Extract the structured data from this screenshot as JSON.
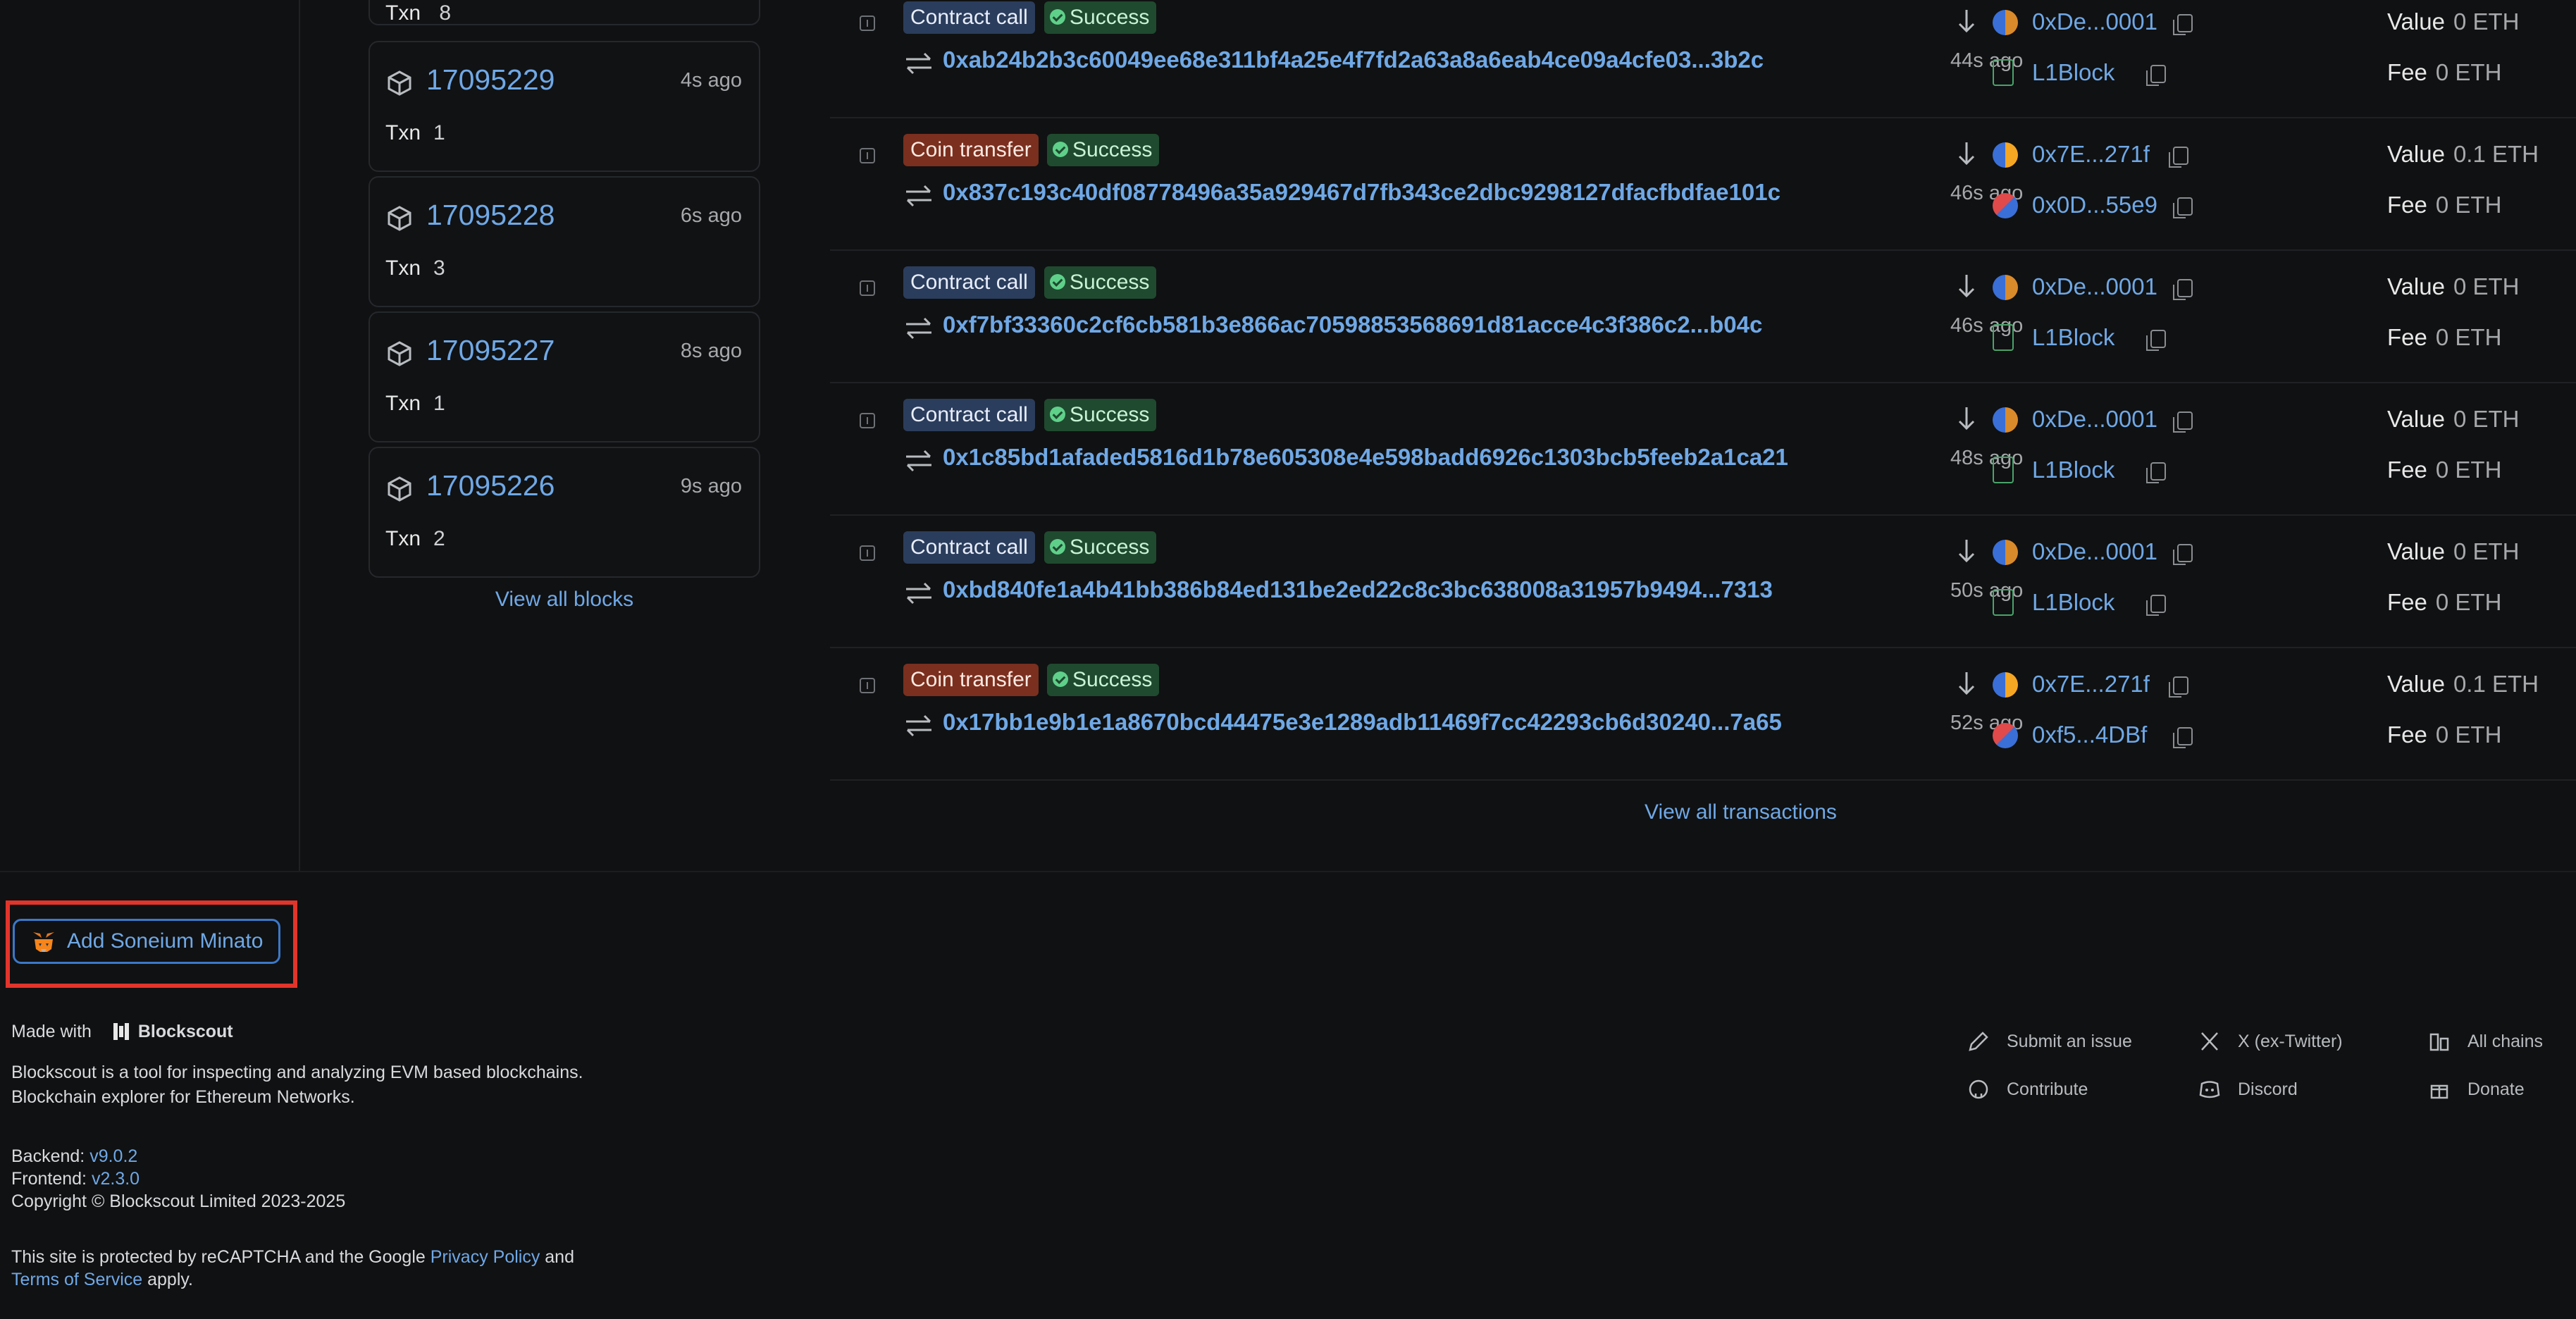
{
  "blocks": {
    "items": [
      {
        "number": "17095229",
        "age": "4s ago",
        "txn_label": "Txn",
        "txn_count": "1"
      },
      {
        "number": "17095228",
        "age": "6s ago",
        "txn_label": "Txn",
        "txn_count": "3"
      },
      {
        "number": "17095227",
        "age": "8s ago",
        "txn_label": "Txn",
        "txn_count": "1"
      },
      {
        "number": "17095226",
        "age": "9s ago",
        "txn_label": "Txn",
        "txn_count": "2"
      }
    ],
    "partial_top_label": "Txn 8",
    "view_all": "View all blocks"
  },
  "transactions": {
    "rows": [
      {
        "type": "Contract call",
        "status": "Success",
        "hash": "0xab24b2b3c60049ee68e311bf4a25e4f7fd2a63a8a6eab4ce09a4cfe03...3b2c",
        "age": "44s ago",
        "from": "0xDe...0001",
        "to": "L1Block",
        "value_label": "Value",
        "value": "0 ETH",
        "fee_label": "Fee",
        "fee": "0 ETH"
      },
      {
        "type": "Coin transfer",
        "status": "Success",
        "hash": "0x837c193c40df08778496a35a929467d7fb343ce2dbc9298127dfacfbdfae101c",
        "age": "46s ago",
        "from": "0x7E...271f",
        "to": "0x0D...55e9",
        "value_label": "Value",
        "value": "0.1 ETH",
        "fee_label": "Fee",
        "fee": "0 ETH"
      },
      {
        "type": "Contract call",
        "status": "Success",
        "hash": "0xf7bf33360c2cf6cb581b3e866ac70598853568691d81acce4c3f386c2...b04c",
        "age": "46s ago",
        "from": "0xDe...0001",
        "to": "L1Block",
        "value_label": "Value",
        "value": "0 ETH",
        "fee_label": "Fee",
        "fee": "0 ETH"
      },
      {
        "type": "Contract call",
        "status": "Success",
        "hash": "0x1c85bd1afaded5816d1b78e605308e4e598badd6926c1303bcb5feeb2a1ca21",
        "age": "48s ago",
        "from": "0xDe...0001",
        "to": "L1Block",
        "value_label": "Value",
        "value": "0 ETH",
        "fee_label": "Fee",
        "fee": "0 ETH"
      },
      {
        "type": "Contract call",
        "status": "Success",
        "hash": "0xbd840fe1a4b41bb386b84ed131be2ed22c8c3bc638008a31957b9494...7313",
        "age": "50s ago",
        "from": "0xDe...0001",
        "to": "L1Block",
        "value_label": "Value",
        "value": "0 ETH",
        "fee_label": "Fee",
        "fee": "0 ETH"
      },
      {
        "type": "Coin transfer",
        "status": "Success",
        "hash": "0x17bb1e9b1e1a8670bcd44475e3e1289adb11469f7cc42293cb6d30240...7a65",
        "age": "52s ago",
        "from": "0x7E...271f",
        "to": "0xf5...4DBf",
        "value_label": "Value",
        "value": "0.1 ETH",
        "fee_label": "Fee",
        "fee": "0 ETH"
      }
    ],
    "view_all": "View all transactions"
  },
  "footer": {
    "add_network_button": "Add Soneium Minato",
    "made_with": "Made with",
    "brand": "Blockscout",
    "desc1": "Blockscout is a tool for inspecting and analyzing EVM based blockchains.",
    "desc2": "Blockchain explorer for Ethereum Networks.",
    "backend_label": "Backend:",
    "backend_version": "v9.0.2",
    "frontend_label": "Frontend:",
    "frontend_version": "v2.3.0",
    "copyright": "Copyright © Blockscout Limited 2023-2025",
    "recaptcha_pre": "This site is protected by reCAPTCHA and the Google",
    "privacy": "Privacy Policy",
    "and": "and",
    "terms": "Terms of Service",
    "apply": "apply.",
    "links": [
      {
        "label": "Submit an issue",
        "icon": "pencil-icon"
      },
      {
        "label": "X (ex-Twitter)",
        "icon": "x-logo-icon"
      },
      {
        "label": "All chains",
        "icon": "buildings-icon"
      },
      {
        "label": "Contribute",
        "icon": "github-icon"
      },
      {
        "label": "Discord",
        "icon": "discord-icon"
      },
      {
        "label": "Donate",
        "icon": "gift-icon"
      }
    ]
  },
  "colors": {
    "background": "#101112",
    "link": "#6fa8e6",
    "contract_tag": "#2b3d5c",
    "coin_tag": "#7a2f1f",
    "success_tag": "#1f4a2f",
    "highlight": "#e2342b"
  }
}
